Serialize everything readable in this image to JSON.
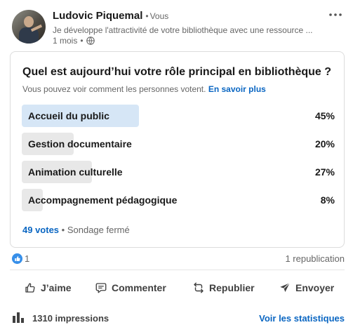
{
  "post": {
    "author_name": "Ludovic Piquemal",
    "author_badge": "Vous",
    "headline": "Je développe l'attractivité de votre bibliothèque avec une ressource ...",
    "time_ago": "1 mois",
    "visibility_icon": "globe-icon",
    "more_icon": "more-horizontal-icon"
  },
  "poll": {
    "question": "Quel est aujourd’hui votre rôle principal en bibliothèque ?",
    "subtext": "Vous pouvez voir comment les personnes votent.",
    "learn_more": "En savoir plus",
    "options": [
      {
        "label": "Accueil du public",
        "percent_text": "45%",
        "percent": 45,
        "selected": true
      },
      {
        "label": "Gestion documentaire",
        "percent_text": "20%",
        "percent": 20,
        "selected": false
      },
      {
        "label": "Animation culturelle",
        "percent_text": "27%",
        "percent": 27,
        "selected": false
      },
      {
        "label": "Accompagnement pédagogique",
        "percent_text": "8%",
        "percent": 8,
        "selected": false
      }
    ],
    "votes": "49 votes",
    "status": "Sondage fermé"
  },
  "social": {
    "reaction_count": "1",
    "reposts": "1 republication"
  },
  "actions": {
    "like": "J’aime",
    "comment": "Commenter",
    "repost": "Republier",
    "send": "Envoyer"
  },
  "stats": {
    "impressions": "1310 impressions",
    "view_stats": "Voir les statistiques"
  },
  "colors": {
    "accent": "#0a66c2",
    "selected_fill": "#d6e6f6",
    "option_fill": "#e8e8e8",
    "like_badge": "#378fe9"
  }
}
